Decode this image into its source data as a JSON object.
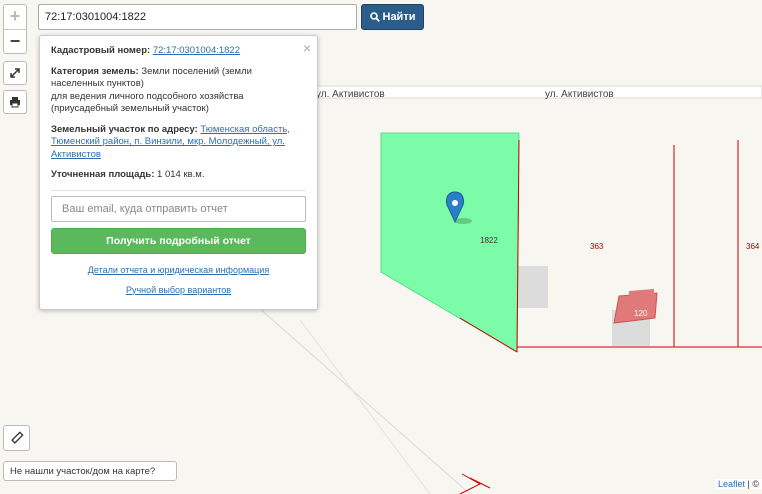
{
  "search": {
    "value": "72:17:0301004:1822",
    "button_label": "Найти"
  },
  "zoom": {
    "in": "+",
    "out": "−"
  },
  "popup": {
    "cadastral_label": "Кадастровый номер:",
    "cadastral_value": "72:17:0301004:1822",
    "category_label": "Категория земель:",
    "category_value": "Земли поселений (земли населенных пунктов)",
    "purpose_value": "для ведения личного подсобного хозяйства (приусадебный земельный участок)",
    "address_label": "Земельный участок по адресу:",
    "address_value": "Тюменская область, Тюменский район, п. Винзили, мкр. Молодежный, ул. Активистов",
    "area_label": "Уточненная площадь:",
    "area_value": "1 014 кв.м.",
    "email_placeholder": "Ваш email, куда отправить отчет",
    "report_button": "Получить подробный отчет",
    "details_link": "Детали отчета и юридическая информация",
    "manual_link": "Ручной выбор вариантов",
    "close": "×"
  },
  "map": {
    "street_labels": [
      "ул. Активистов",
      "ул. Активистов"
    ],
    "parcel_labels": [
      "1822",
      "363",
      "364",
      "120"
    ]
  },
  "not_found_label": "Не нашли участок/дом на карте?",
  "attribution": {
    "leaflet": "Leaflet",
    "suffix": "| ©"
  },
  "colors": {
    "parcel_fill": "#7cfca8",
    "boundary": "#cc0000",
    "marker": "#2a7fc9",
    "report_button": "#5cb85c",
    "search_button": "#2b5d8a"
  }
}
